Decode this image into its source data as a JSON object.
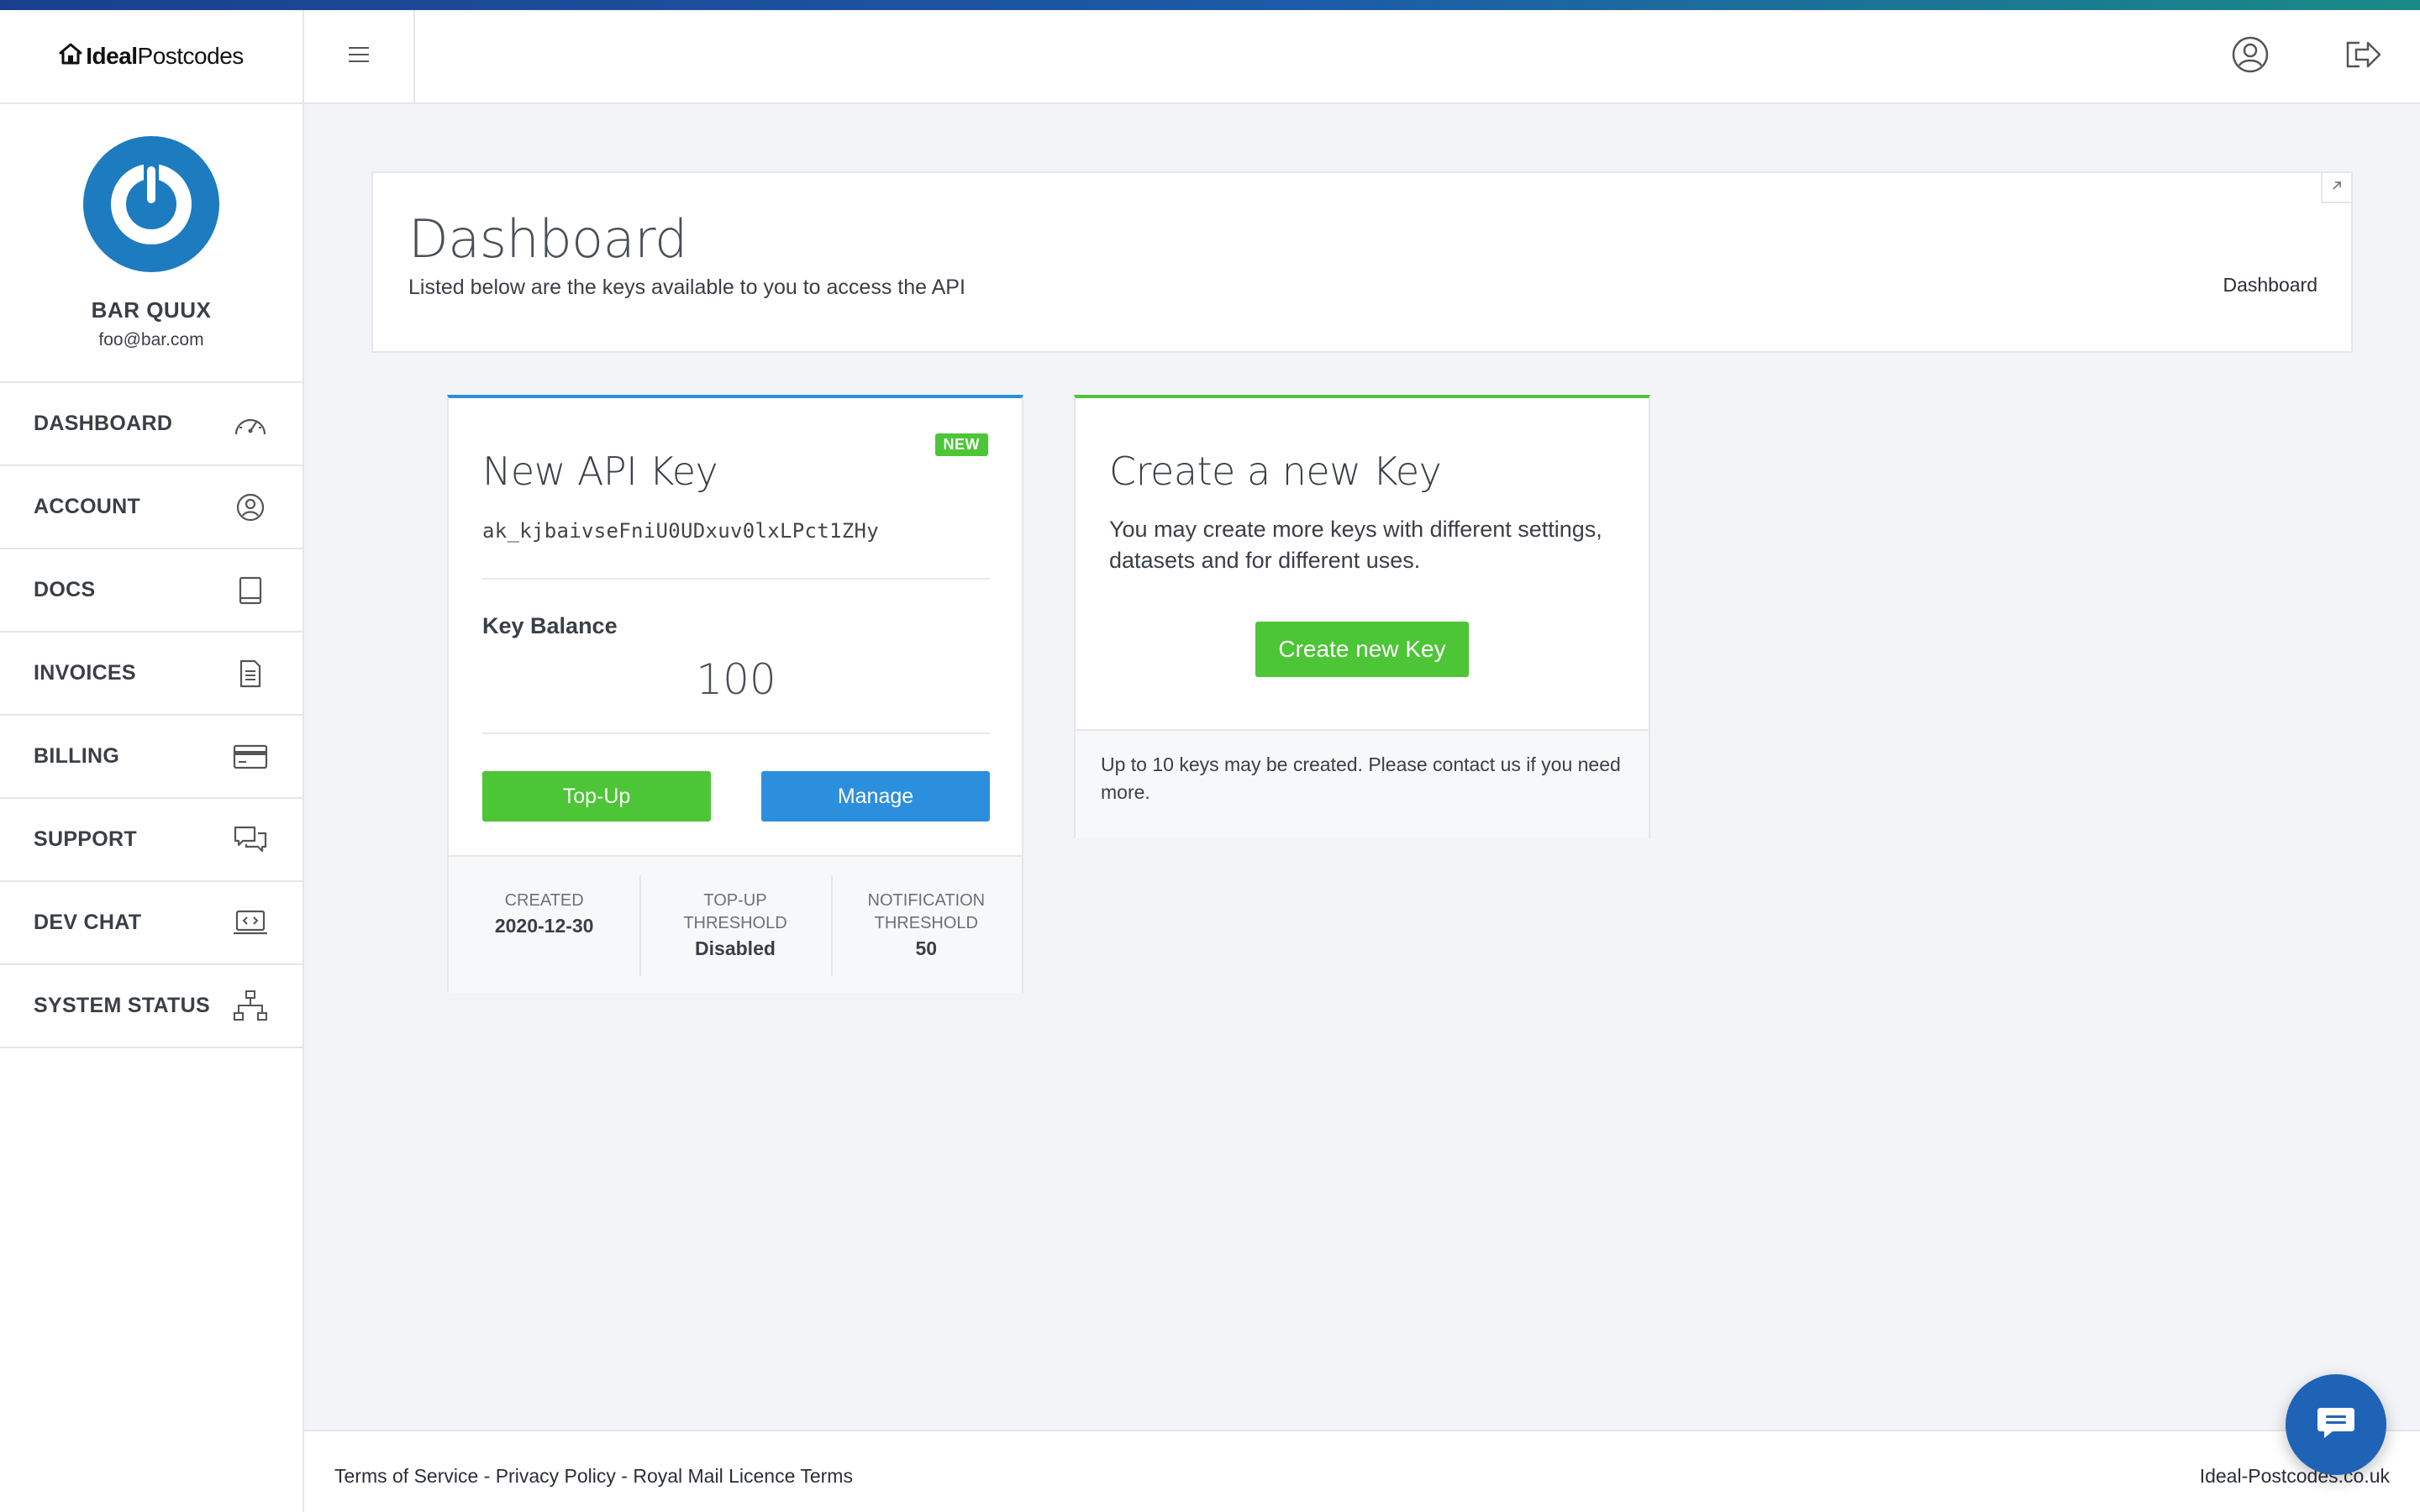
{
  "brand": {
    "logo_bold": "Ideal",
    "logo_light": "Postcodes"
  },
  "profile": {
    "name": "BAR QUUX",
    "email": "foo@bar.com"
  },
  "sidebar": {
    "items": [
      {
        "label": "DASHBOARD",
        "icon": "speedometer-icon"
      },
      {
        "label": "ACCOUNT",
        "icon": "user-circle-icon"
      },
      {
        "label": "DOCS",
        "icon": "book-icon"
      },
      {
        "label": "INVOICES",
        "icon": "document-icon"
      },
      {
        "label": "BILLING",
        "icon": "credit-card-icon"
      },
      {
        "label": "SUPPORT",
        "icon": "chat-bubbles-icon"
      },
      {
        "label": "DEV CHAT",
        "icon": "laptop-code-icon"
      },
      {
        "label": "SYSTEM STATUS",
        "icon": "network-icon"
      }
    ]
  },
  "header": {
    "title": "Dashboard",
    "subtitle": "Listed below are the keys available to you to access the API",
    "breadcrumb": "Dashboard"
  },
  "key_card": {
    "badge": "NEW",
    "title": "New API Key",
    "key_id": "ak_kjbaivseFniU0UDxuv0lxLPct1ZHy",
    "balance_label": "Key Balance",
    "balance_value": "100",
    "topup_label": "Top-Up",
    "manage_label": "Manage",
    "stats": [
      {
        "label_line1": "CREATED",
        "label_line2": "",
        "value": "2020-12-30"
      },
      {
        "label_line1": "TOP-UP",
        "label_line2": "THRESHOLD",
        "value": "Disabled"
      },
      {
        "label_line1": "NOTIFICATION",
        "label_line2": "THRESHOLD",
        "value": "50"
      }
    ]
  },
  "create_card": {
    "title": "Create a new Key",
    "text": "You may create more keys with different settings, datasets and for different uses.",
    "button_label": "Create new Key",
    "footer_text": "Up to 10 keys may be created. Please contact us if you need more."
  },
  "footer": {
    "terms": "Terms of Service",
    "privacy": "Privacy Policy",
    "licence": "Royal Mail Licence Terms",
    "separator": " - ",
    "right_text": "Ideal-Postcodes.co.uk"
  },
  "colors": {
    "accent_blue": "#2c8fde",
    "accent_green": "#4cc536",
    "chat_blue": "#1f63b6"
  }
}
